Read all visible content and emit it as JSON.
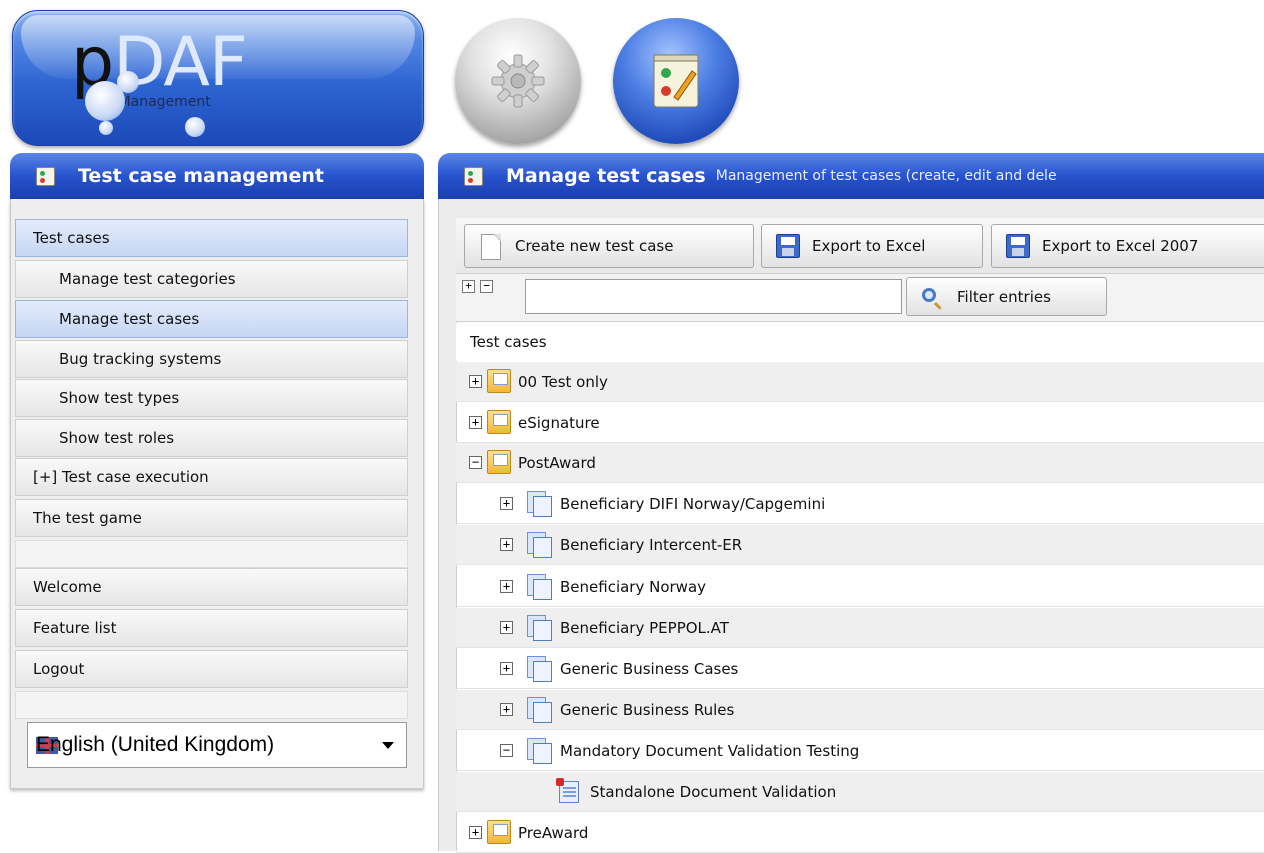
{
  "logo": {
    "main": "pDAF",
    "sub": "TestManagement"
  },
  "top_icons": [
    {
      "name": "settings",
      "icon": "gear-icon"
    },
    {
      "name": "test-management",
      "icon": "checklist-icon"
    }
  ],
  "sidebar": {
    "title": "Test case management",
    "items": [
      {
        "label": "Test cases",
        "level": 1,
        "active": true
      },
      {
        "label": "Manage test categories",
        "level": 2,
        "active": false
      },
      {
        "label": "Manage test cases",
        "level": 2,
        "active": true
      },
      {
        "label": "Bug tracking systems",
        "level": 2,
        "active": false
      },
      {
        "label": "Show test types",
        "level": 2,
        "active": false
      },
      {
        "label": "Show test roles",
        "level": 2,
        "active": false
      },
      {
        "label": "[+] Test case execution",
        "level": 1,
        "active": false
      },
      {
        "label": "The test game",
        "level": 1,
        "active": false
      },
      {
        "label": "Welcome",
        "level": 1,
        "active": false
      },
      {
        "label": "Feature list",
        "level": 1,
        "active": false
      },
      {
        "label": "Logout",
        "level": 1,
        "active": false
      }
    ],
    "language": {
      "selected": "English (United Kingdom)"
    }
  },
  "main": {
    "title": "Manage test cases",
    "subtitle": "Management of test cases (create, edit and dele",
    "toolbar": {
      "create": "Create new test case",
      "export_excel": "Export to Excel",
      "export_excel_2007": "Export to Excel 2007"
    },
    "expand_all": "+",
    "collapse_all": "−",
    "filter": {
      "value": "",
      "button": "Filter entries"
    },
    "tree": {
      "header": "Test cases",
      "rows": [
        {
          "label": "00 Test only",
          "depth": 0,
          "expander": "+",
          "kind": "folder"
        },
        {
          "label": "eSignature",
          "depth": 0,
          "expander": "+",
          "kind": "folder"
        },
        {
          "label": "PostAward",
          "depth": 0,
          "expander": "−",
          "kind": "folder"
        },
        {
          "label": "Beneficiary DIFI Norway/Capgemini",
          "depth": 1,
          "expander": "+",
          "kind": "group"
        },
        {
          "label": "Beneficiary Intercent-ER",
          "depth": 1,
          "expander": "+",
          "kind": "group"
        },
        {
          "label": "Beneficiary Norway",
          "depth": 1,
          "expander": "+",
          "kind": "group"
        },
        {
          "label": "Beneficiary PEPPOL.AT",
          "depth": 1,
          "expander": "+",
          "kind": "group"
        },
        {
          "label": "Generic Business Cases",
          "depth": 1,
          "expander": "+",
          "kind": "group"
        },
        {
          "label": "Generic Business Rules",
          "depth": 1,
          "expander": "+",
          "kind": "group"
        },
        {
          "label": "Mandatory Document Validation Testing",
          "depth": 1,
          "expander": "−",
          "kind": "group"
        },
        {
          "label": "Standalone Document Validation",
          "depth": 2,
          "expander": "",
          "kind": "case"
        },
        {
          "label": "PreAward",
          "depth": 0,
          "expander": "+",
          "kind": "folder"
        }
      ]
    }
  },
  "colors": {
    "header_blue": "#2753cf",
    "active_item": "#c5d6f3"
  }
}
